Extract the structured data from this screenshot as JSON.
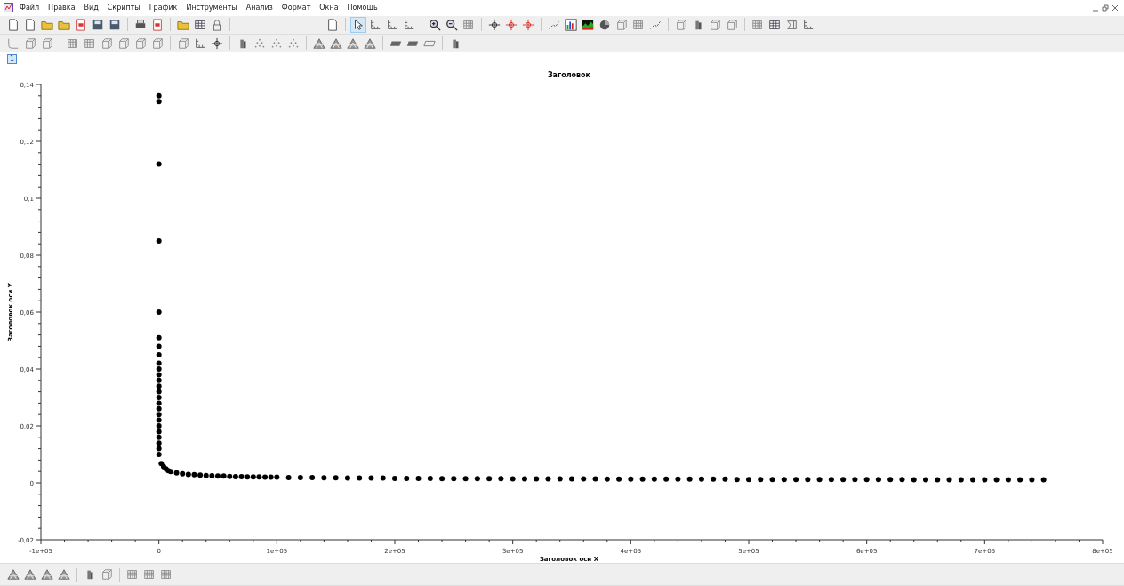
{
  "menu": [
    "Файл",
    "Правка",
    "Вид",
    "Скрипты",
    "График",
    "Инструменты",
    "Анализ",
    "Формат",
    "Окна",
    "Помощь"
  ],
  "main_toolbar": {
    "pointer_tool_selected": true
  },
  "graph_tabs": [
    {
      "label": "1",
      "selected": true
    }
  ],
  "plot": {
    "chart_data": {
      "type": "scatter",
      "title": "Заголовок",
      "xlabel": "Заголовок оси X",
      "ylabel": "Заголовок оси Y",
      "xlim": [
        -100000,
        800000
      ],
      "ylim": [
        -0.02,
        0.14
      ],
      "xticks": [
        {
          "value": -100000,
          "label": "-1e+05"
        },
        {
          "value": 0,
          "label": "0"
        },
        {
          "value": 100000,
          "label": "1e+05"
        },
        {
          "value": 200000,
          "label": "2e+05"
        },
        {
          "value": 300000,
          "label": "3e+05"
        },
        {
          "value": 400000,
          "label": "4e+05"
        },
        {
          "value": 500000,
          "label": "5e+05"
        },
        {
          "value": 600000,
          "label": "6e+05"
        },
        {
          "value": 700000,
          "label": "7e+05"
        },
        {
          "value": 800000,
          "label": "8e+05"
        }
      ],
      "yticks": [
        {
          "value": -0.02,
          "label": "-0,02"
        },
        {
          "value": 0,
          "label": "0"
        },
        {
          "value": 0.02,
          "label": "0,02"
        },
        {
          "value": 0.04,
          "label": "0,04"
        },
        {
          "value": 0.06,
          "label": "0,06"
        },
        {
          "value": 0.08,
          "label": "0,08"
        },
        {
          "value": 0.1,
          "label": "0,1"
        },
        {
          "value": 0.12,
          "label": "0,12"
        },
        {
          "value": 0.14,
          "label": "0,14"
        }
      ],
      "x": [
        0,
        0,
        0,
        0,
        0,
        0,
        0,
        0,
        0,
        0,
        0,
        0,
        0,
        0,
        0,
        0,
        0,
        0,
        0,
        0,
        0,
        0,
        0,
        0,
        0,
        2000,
        4000,
        6000,
        8000,
        10000,
        15000,
        20000,
        25000,
        30000,
        35000,
        40000,
        45000,
        50000,
        55000,
        60000,
        65000,
        70000,
        75000,
        80000,
        85000,
        90000,
        95000,
        100000,
        110000,
        120000,
        130000,
        140000,
        150000,
        160000,
        170000,
        180000,
        190000,
        200000,
        210000,
        220000,
        230000,
        240000,
        250000,
        260000,
        270000,
        280000,
        290000,
        300000,
        310000,
        320000,
        330000,
        340000,
        350000,
        360000,
        370000,
        380000,
        390000,
        400000,
        410000,
        420000,
        430000,
        440000,
        450000,
        460000,
        470000,
        480000,
        490000,
        500000,
        510000,
        520000,
        530000,
        540000,
        550000,
        560000,
        570000,
        580000,
        590000,
        600000,
        610000,
        620000,
        630000,
        640000,
        650000,
        660000,
        670000,
        680000,
        690000,
        700000,
        710000,
        720000,
        730000,
        740000,
        750000
      ],
      "series": [
        {
          "color": "#000000",
          "values": [
            0.136,
            0.134,
            0.112,
            0.085,
            0.06,
            0.051,
            0.048,
            0.045,
            0.042,
            0.04,
            0.038,
            0.036,
            0.034,
            0.032,
            0.03,
            0.028,
            0.026,
            0.024,
            0.022,
            0.02,
            0.018,
            0.016,
            0.014,
            0.012,
            0.01,
            0.0068,
            0.0057,
            0.0049,
            0.0043,
            0.004,
            0.0035,
            0.0032,
            0.003,
            0.0029,
            0.0027,
            0.0026,
            0.0025,
            0.0024,
            0.0024,
            0.0023,
            0.0022,
            0.0022,
            0.0021,
            0.0021,
            0.0021,
            0.002,
            0.002,
            0.002,
            0.0019,
            0.0019,
            0.0019,
            0.0018,
            0.0018,
            0.0017,
            0.0017,
            0.0017,
            0.0017,
            0.0016,
            0.0016,
            0.0016,
            0.0016,
            0.0015,
            0.0015,
            0.0015,
            0.0015,
            0.0015,
            0.0015,
            0.0014,
            0.0014,
            0.0014,
            0.0014,
            0.0014,
            0.0014,
            0.0014,
            0.0014,
            0.0013,
            0.0013,
            0.0013,
            0.0013,
            0.0013,
            0.0013,
            0.0013,
            0.0013,
            0.0013,
            0.0013,
            0.0013,
            0.0012,
            0.0012,
            0.0012,
            0.0012,
            0.0012,
            0.0012,
            0.0012,
            0.0012,
            0.0012,
            0.0012,
            0.0012,
            0.0012,
            0.0012,
            0.0012,
            0.0012,
            0.0011,
            0.0011,
            0.0011,
            0.0011,
            0.0011,
            0.0011,
            0.0011,
            0.0011,
            0.0011,
            0.0011,
            0.0011,
            0.0011
          ]
        }
      ]
    }
  }
}
